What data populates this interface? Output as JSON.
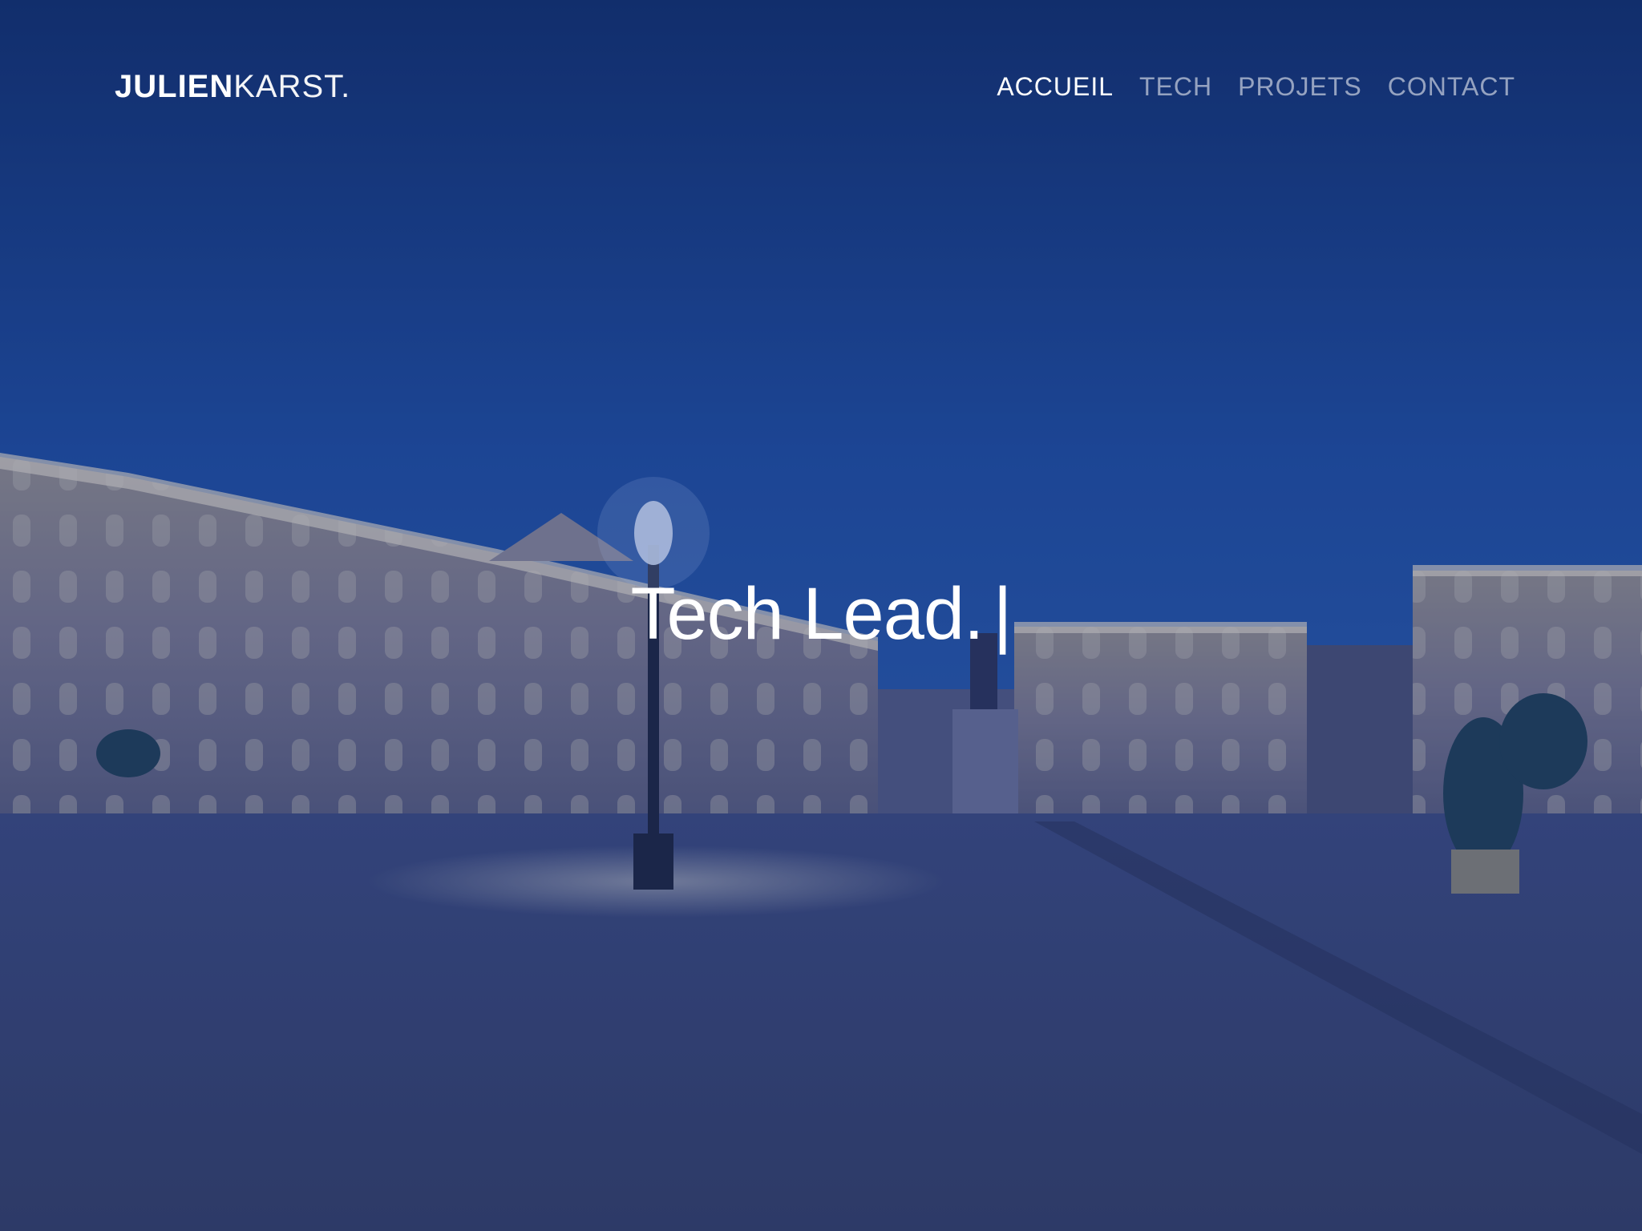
{
  "brand": {
    "bold": "JULIEN",
    "light": "KARST."
  },
  "nav": {
    "items": [
      {
        "label": "ACCUEIL",
        "active": true
      },
      {
        "label": "TECH",
        "active": false
      },
      {
        "label": "PROJETS",
        "active": false
      },
      {
        "label": "CONTACT",
        "active": false
      }
    ]
  },
  "hero": {
    "headline": "Tech Lead.",
    "cursor": "|",
    "overlay_color": "#1a3a85"
  }
}
